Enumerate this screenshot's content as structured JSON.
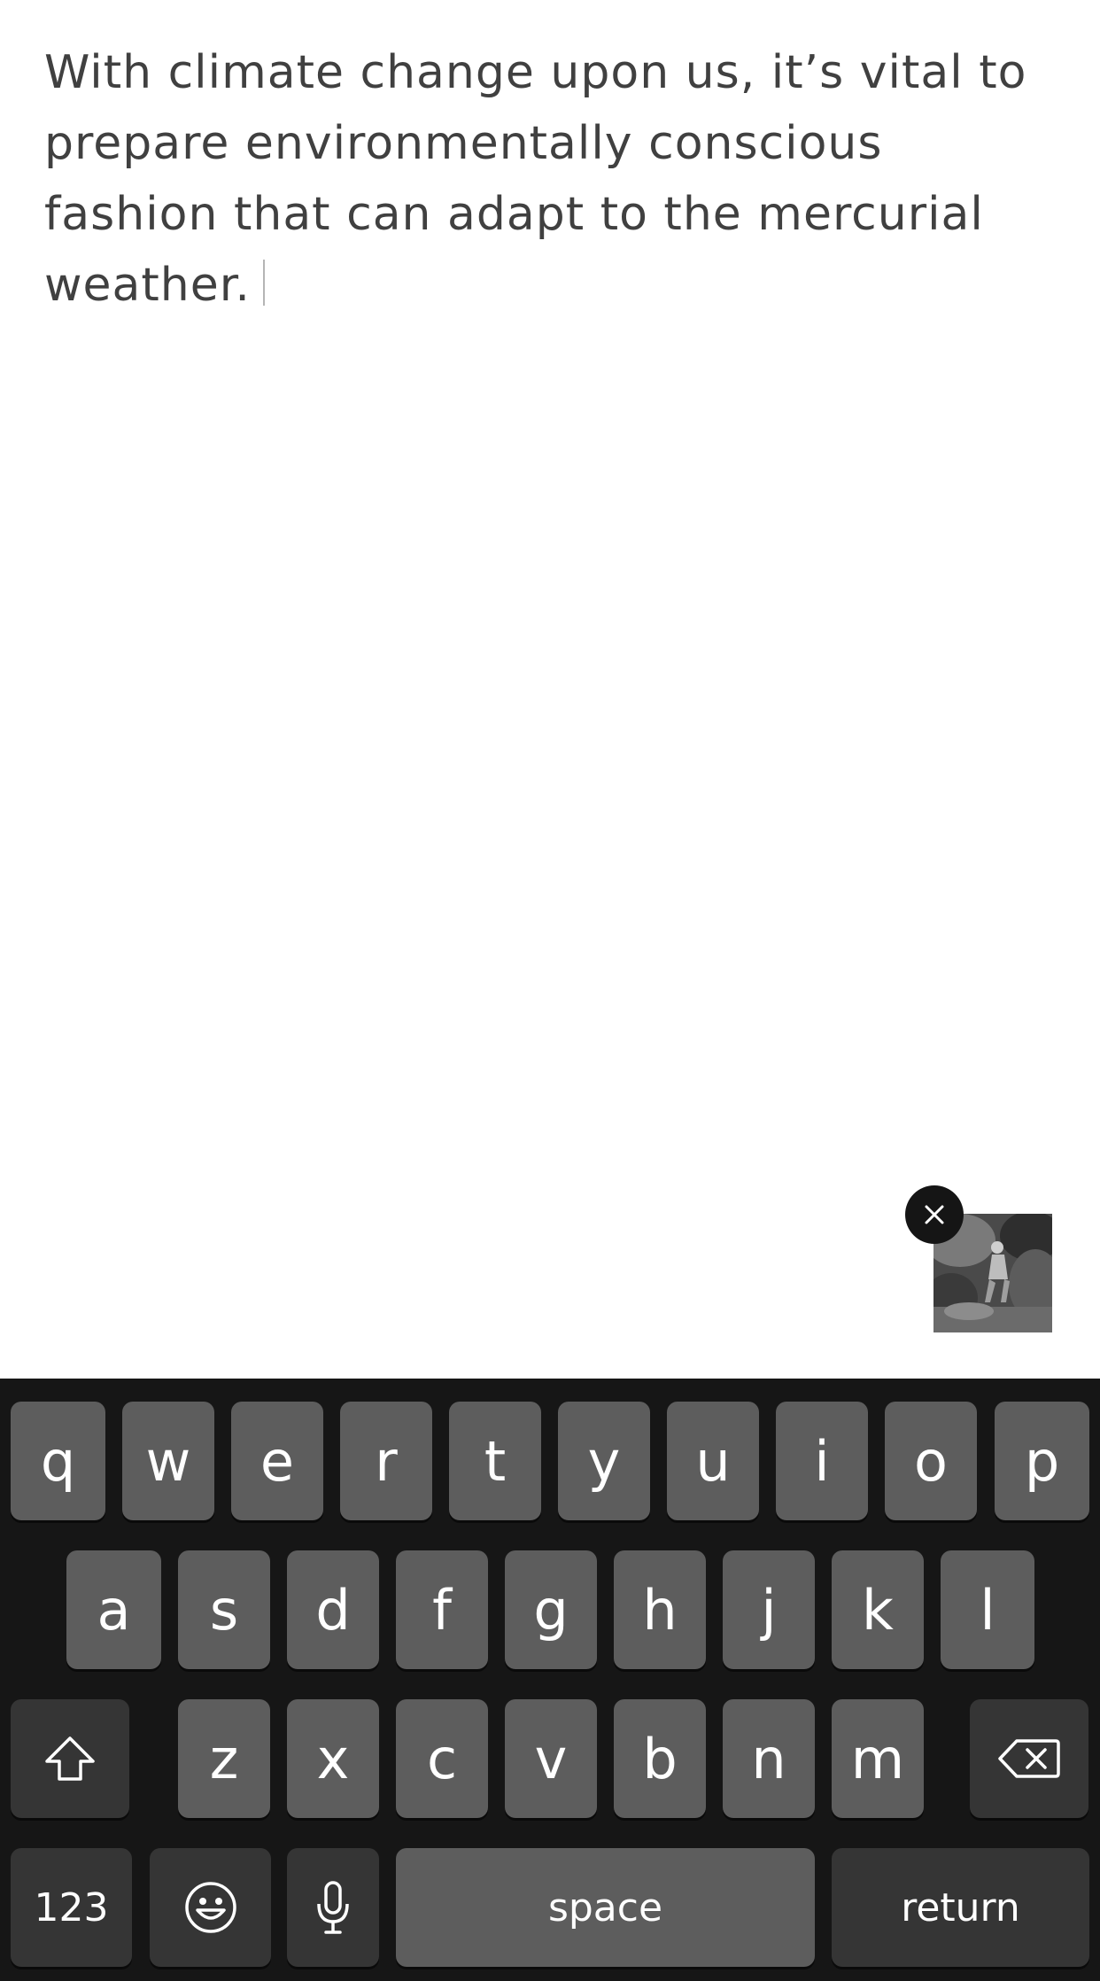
{
  "editor": {
    "text": "With climate change upon us, it’s vital to prepare environmentally conscious fashion that can adapt to the mercurial weather."
  },
  "attachment": {
    "remove_icon": "close-icon",
    "image": "photo-thumbnail"
  },
  "keyboard": {
    "row1": [
      "q",
      "w",
      "e",
      "r",
      "t",
      "y",
      "u",
      "i",
      "o",
      "p"
    ],
    "row2": [
      "a",
      "s",
      "d",
      "f",
      "g",
      "h",
      "j",
      "k",
      "l"
    ],
    "row3": [
      "z",
      "x",
      "c",
      "v",
      "b",
      "n",
      "m"
    ],
    "numbers_label": "123",
    "space_label": "space",
    "return_label": "return",
    "icons": {
      "shift": "shift-icon",
      "delete": "backspace-icon",
      "emoji": "emoji-icon",
      "mic": "microphone-icon"
    },
    "colors": {
      "background": "#161616",
      "key": "#5d5d5d",
      "special_key": "#353535",
      "key_text": "#ffffff"
    }
  }
}
